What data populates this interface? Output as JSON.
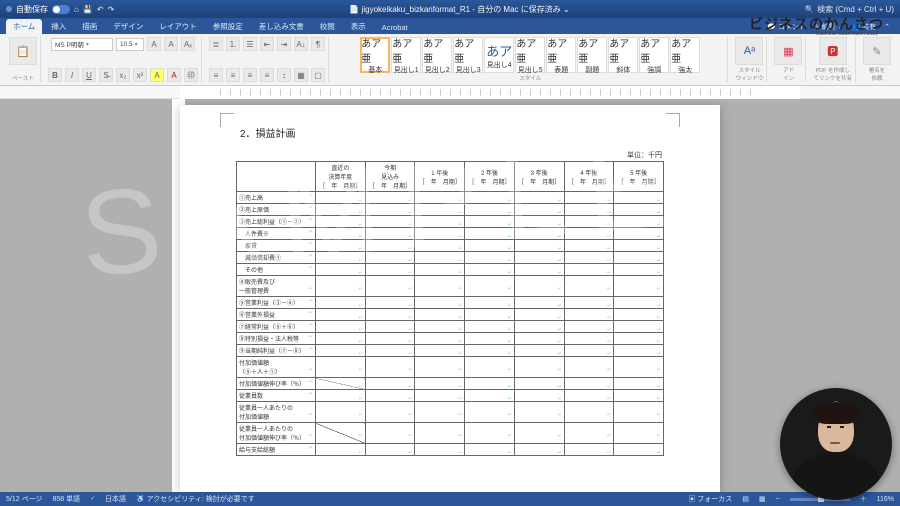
{
  "titlebar": {
    "autosave": "自動保存",
    "filename": "jigyokeikaku_bizkanformat_R1 - 自分の Mac に保存済み",
    "search_placeholder": "検索 (Cmd + Ctrl + U)"
  },
  "tabs": {
    "home": "ホーム",
    "insert": "挿入",
    "draw": "描画",
    "design": "デザイン",
    "layout": "レイアウト",
    "references": "参照設定",
    "mailings": "差し込み文書",
    "review": "校閲",
    "view": "表示",
    "acrobat": "Acrobat"
  },
  "ribbon_right": {
    "comments": "コメント",
    "editing": "編集",
    "share": "共有"
  },
  "ribbon": {
    "paste": "ペースト",
    "font_name": "MS P明朝",
    "font_size": "10.5",
    "styles_label": "スタイル",
    "style_sample_jp": "あア亜",
    "style_sample_big": "あア",
    "style_names": [
      "基本",
      "見出し1",
      "見出し2",
      "見出し3",
      "見出し4",
      "見出し5",
      "表題",
      "副題",
      "斜体",
      "強調",
      "強太"
    ],
    "pane": "スタイル\nウィンドウ",
    "addins": "アド\nイン",
    "pdf_create": "PDF を作成し\nてリンクを共有",
    "sign": "署名を\n依頼"
  },
  "document": {
    "heading": "2．損益計画",
    "unit": "単位：千円",
    "columns": [
      "直近の\n決算年度\n［　年　月期］",
      "今期\n見込み\n［　年　月期］",
      "1 年後\n［　年　月期］",
      "2 年後\n［　年　月期］",
      "3 年後\n［　年　月期］",
      "4 年後\n［　年　月期］",
      "5 年後\n［　年　月期］"
    ],
    "rows": [
      "①売上高",
      "②売上原価",
      "③売上総利益（①－②）",
      "人件費※",
      "家賃",
      "減価償却費①",
      "その他",
      "④販売費及び\n一般管理費",
      "⑤営業利益（③－④）",
      "⑥営業外損益",
      "⑦経常利益（⑤＋⑥）",
      "⑧特別損益・法人税等",
      "⑨当期純利益（⑦－⑧）",
      "付加価値額\n（⑤＋人＋①）",
      "付加価値額伸び率（％）",
      "従業員数",
      "従業員一人あたりの\n付加価値額",
      "従業員一人あたりの\n付加価値額伸び率（％）",
      "給与支給総額"
    ],
    "diag_rows": [
      14,
      17
    ]
  },
  "statusbar": {
    "page": "5/12 ページ",
    "words": "858 単語",
    "lang": "日本語",
    "accessibility": "アクセシビリティ: 検討が必要です",
    "focus": "フォーカス",
    "zoom": "116%"
  },
  "overlay": {
    "watermark": "SAMPLE",
    "channel": "ビジネスのかんさつ",
    "channel_sub": "Business Observation Diary"
  }
}
